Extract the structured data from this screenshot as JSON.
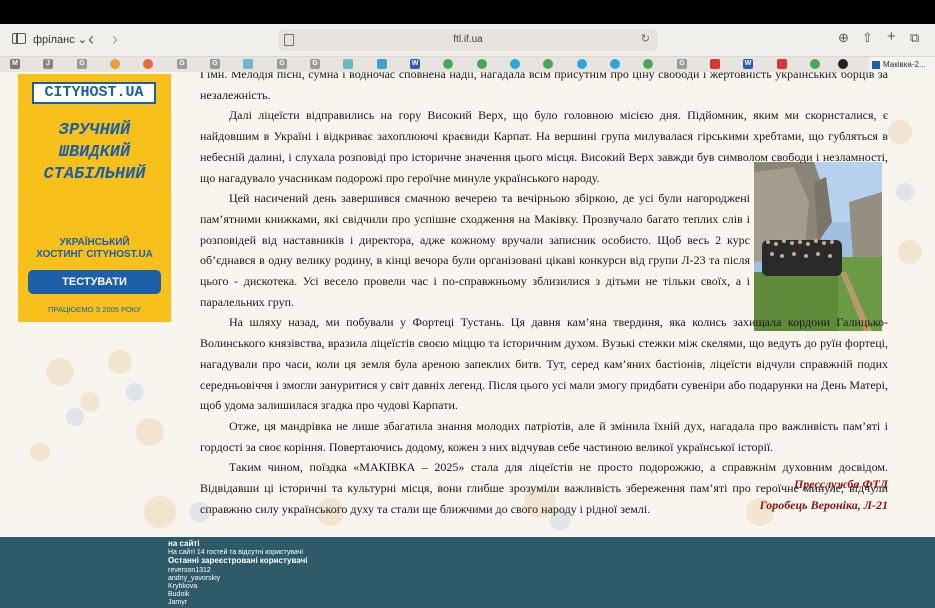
{
  "browser": {
    "profile_label": "фріланс",
    "url": "ftl.if.ua",
    "active_tab_label": "Маківка-2..."
  },
  "ad": {
    "logo": "CITYHOST.UA",
    "slogan": [
      "ЗРУЧНИЙ",
      "ШВИДКИЙ",
      "СТАБІЛЬНИЙ"
    ],
    "subtitle_line1": "УКРАЇНСЬКИЙ",
    "subtitle_line2": "ХОСТИНГ CITYHOST.UA",
    "button": "ТЕСТУВАТИ",
    "footer": "ПРАЦЮЄМО З 2005 РОКУ"
  },
  "article": {
    "paragraphs": [
      "Гімн. Мелодія пісні, сумна і водночас сповнена надії, нагадала всім присутнім про ціну свободи і жертовність українських борців за незалежність.",
      "Далі ліцеїсти відправились на гору Високий Верх, що було головною місією дня. Підйомник, яким ми скористалися, є найдовшим в Україні і відкриває захоплюючі краєвиди Карпат. На вершині група милувалася гірськими хребтами, що губляться в небесній далині, і слухала розповіді про історичне значення цього місця. Високий Верх завжди був символом свободи і незламності, що нагадувало учасникам подорожі про героїчне минуле українського народу.",
      "Цей насичений день завершився смачною вечерею та вечірньою збіркою, де усі були нагороджені пам’ятними книжками, які свідчили про успішне сходження на Маківку. Прозвучало багато теплих слів і розповідей від наставників і директора, адже кожному вручали записник особисто. Щоб весь 2 курс об’єднався в одну велику родину, в кінці вечора були організовані цікаві конкурси від групи Л-23 та після цього - дискотека. Усі весело провели час і по-справжньому зблизилися з дітьми не тільки своїх, а і паралельних груп.",
      "На шляху назад, ми побували у Фортеці Тустань. Ця давня кам’яна твердиня, яка колись захищала кордони Галицько-Волинського князівства, вразила ліцеїстів своєю міццю та історичним духом. Вузькі стежки між скелями, що ведуть до руїн фортеці, нагадували про часи, коли ця земля була ареною запеклих битв. Тут, серед кам’яних бастіонів, ліцеїсти відчули справжній подих середньовіччя і змогли зануритися у світ давніх легенд. Після цього усі мали змогу придбати сувеніри або подарунки на День Матері, щоб удома залишилася згадка про чудові Карпати.",
      "Отже, ця мандрівка не лише збагатила знання молодих патріотів, але й змінила їхній дух, нагадала про важливість пам’яті і гордості за своє коріння. Повертаючись додому, кожен з них відчував себе частиною великої української історії.",
      "Таким чином, поїздка «МАКІВКА – 2025» стала для ліцеїстів не просто подорожжю, а справжнім духовним досвідом. Відвідавши ці історичні та культурні місця, вони глибше зрозуміли важливість збереження пам’яті про героїчне минуле, відчули справжню силу українського духу та стали ще ближчими до свого народу і рідної землі."
    ],
    "signature_1": "Пресслужба ФТЛ",
    "signature_2": "Горобець Вероніка, Л-21"
  },
  "footer": {
    "title": "на сайті",
    "online_text": "На сайті 14 гостей та відсутні користувачі",
    "recent_title": "Останні зареєстровані користувачі",
    "users": [
      "reverson1312",
      "andriy_yavorskiy",
      "Kryhkova",
      "Budnik",
      "Jamyr"
    ]
  }
}
